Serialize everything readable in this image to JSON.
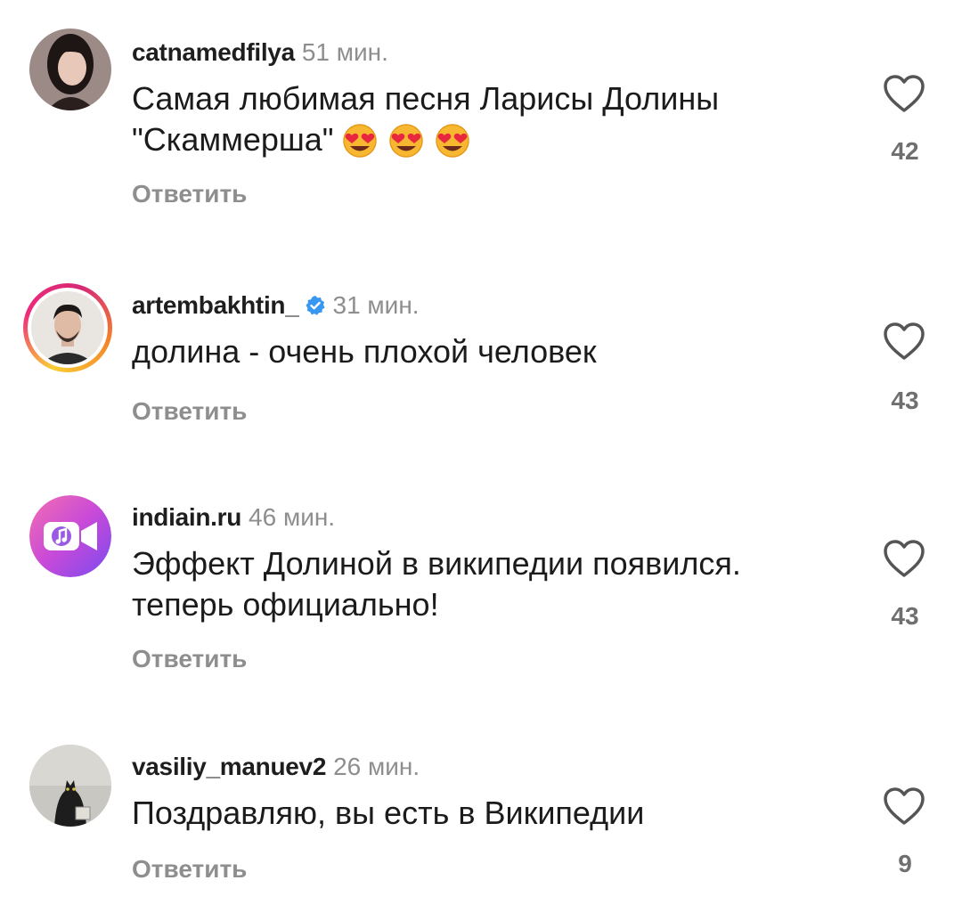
{
  "comments": [
    {
      "username": "catnamedfilya",
      "time": "51 мин.",
      "text_line1": "Самая любимая песня Ларисы Долины",
      "text_line2": "\"Скаммерша\"",
      "emojis": [
        "heart-eyes",
        "heart-eyes",
        "heart-eyes"
      ],
      "reply": "Ответить",
      "likes": "42",
      "verified": false
    },
    {
      "username": "artembakhtin_",
      "time": "31 мин.",
      "text_line1": "долина - очень плохой человек",
      "reply": "Ответить",
      "likes": "43",
      "verified": true,
      "has_story_ring": true
    },
    {
      "username": "indiain.ru",
      "time": "46 мин.",
      "text_line1": "Эффект Долиной в википедии появился.",
      "text_line2": "теперь официально!",
      "reply": "Ответить",
      "likes": "43",
      "verified": false
    },
    {
      "username": "vasiliy_manuev2",
      "time": "26 мин.",
      "text_line1": "Поздравляю, вы есть в Википедии",
      "reply": "Ответить",
      "likes": "9",
      "verified": false
    }
  ],
  "colors": {
    "text": "#1b1b1b",
    "muted": "#8e8e8e",
    "verified_blue": "#3897f0"
  }
}
